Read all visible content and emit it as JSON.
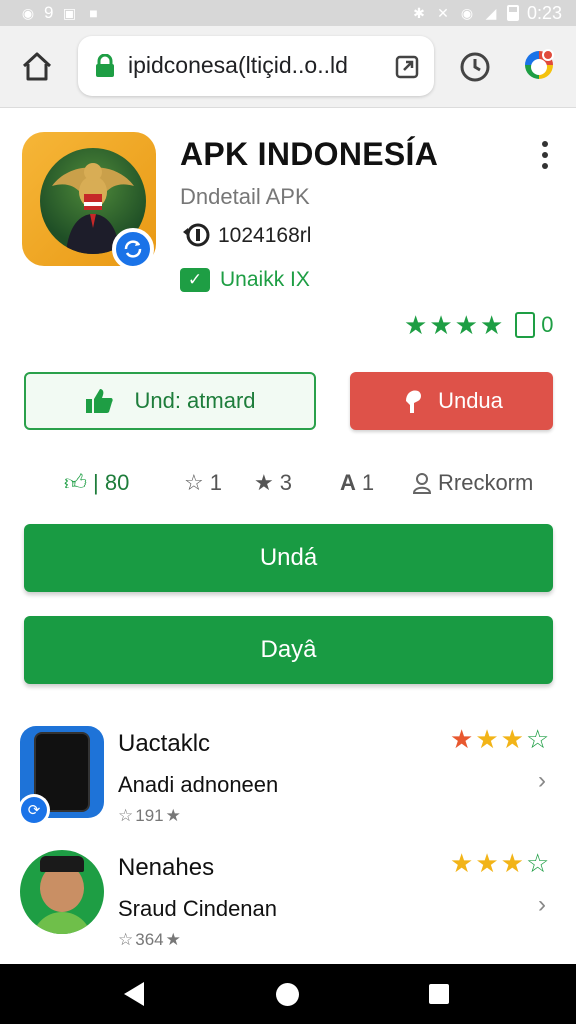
{
  "status_bar": {
    "left_text": "9",
    "time": "0:23"
  },
  "browser": {
    "url": "ipidconesa(ltiçid..o..ld"
  },
  "app": {
    "title": "APK INDONESÍA",
    "subtitle": "Dndetail APK",
    "count": "1024168rl",
    "verified": "Unaikk IX",
    "rating_count": "0",
    "stars": 4,
    "star_color": "#1e9e44"
  },
  "actions": {
    "outline_label": "Und: atmard",
    "red_label": "Undua",
    "red_color": "#de5249"
  },
  "stats": [
    {
      "icon": "thumbs-up-icon",
      "value": "| 80"
    },
    {
      "icon": "badge-icon",
      "value": "1"
    },
    {
      "icon": "star-icon",
      "value": "3"
    },
    {
      "icon": "font-icon",
      "value": "1"
    },
    {
      "icon": "person-icon",
      "value": "Rreckorm"
    }
  ],
  "buttons": {
    "primary": "Undá",
    "secondary": "Dayâ",
    "green_color": "#199b43"
  },
  "list": [
    {
      "title": "Uactaklc",
      "subtitle": "Anadi adnoneen",
      "meta": "191",
      "stars": [
        "orange",
        "gold",
        "gold",
        "outline"
      ]
    },
    {
      "title": "Nenahes",
      "subtitle": "Sraud Cindenan",
      "meta": "364",
      "stars": [
        "gold",
        "gold",
        "gold",
        "outline"
      ]
    }
  ]
}
